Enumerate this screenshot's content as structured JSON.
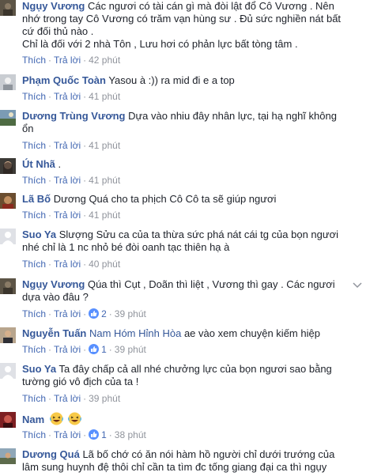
{
  "comments": [
    {
      "author": "Ngụy Vương",
      "tag": "",
      "lines": [
        "Các ngươi có tài cán gì mà đòi lật đổ Cô Vương . Nên",
        "nhớ trong tay Cô Vương có trăm vạn hùng sư . Đủ sức nghiền nát bất",
        "cứ đối thủ nào .",
        "Chỉ là đối với 2 nhà Tôn , Lưu hơi có phản lực bất tòng tâm ."
      ],
      "like": "Thích",
      "reply": "Trả lời",
      "reactions": "",
      "time": "42 phút",
      "avatar": "dark-warrior-avatar"
    },
    {
      "author": "Phạm Quốc Toàn",
      "tag": "",
      "lines": [
        "Yasou à :)) ra mid đi e a top"
      ],
      "like": "Thích",
      "reply": "Trả lời",
      "reactions": "",
      "time": "41 phút",
      "avatar": "silver-avatar"
    },
    {
      "author": "Dương Trùng Vương",
      "tag": "",
      "lines": [
        "Dựa vào nhiu đây nhân lực, tại hạ nghĩ không",
        "ổn"
      ],
      "like": "Thích",
      "reply": "Trả lời",
      "reactions": "",
      "time": "41 phút",
      "avatar": "landscape-avatar"
    },
    {
      "author": "Út Nhã",
      "tag": "",
      "lines": [
        "."
      ],
      "like": "Thích",
      "reply": "Trả lời",
      "reactions": "",
      "time": "41 phút",
      "avatar": "woman-avatar"
    },
    {
      "author": "Lã Bố",
      "tag": "",
      "lines": [
        "Dương Quá cho ta phịch Cô Cô ta sẽ giúp ngươi"
      ],
      "like": "Thích",
      "reply": "Trả lời",
      "reactions": "",
      "time": "41 phút",
      "avatar": "warrior-avatar"
    },
    {
      "author": "Suo Ya",
      "tag": "",
      "lines": [
        "Slượng Sửu ca của ta thừa sức phá nát cái tg của bọn ngươi",
        "nhé chỉ là 1 nc nhỏ bé đòi oanh tạc thiên hạ à"
      ],
      "like": "Thích",
      "reply": "Trả lời",
      "reactions": "",
      "time": "40 phút",
      "avatar": "default-avatar"
    },
    {
      "author": "Ngụy Vương",
      "tag": "",
      "lines": [
        "Qúa thì Cụt , Doãn thì liệt , Vương thì gay . Các ngươi",
        "dựa vào đâu ?"
      ],
      "like": "Thích",
      "reply": "Trả lời",
      "reactions": "2",
      "time": "39 phút",
      "avatar": "dark-warrior-avatar"
    },
    {
      "author": "Nguyễn Tuấn",
      "tag": "Nam Hóm Hỉnh Hòa",
      "lines": [
        "ae vào xem chuyện kiếm hiệp"
      ],
      "like": "Thích",
      "reply": "Trả lời",
      "reactions": "1",
      "time": "39 phút",
      "avatar": "man-avatar"
    },
    {
      "author": "Suo Ya",
      "tag": "",
      "lines": [
        "Ta đây chấp cả all nhé chưởng lực của bọn ngươi sao bằng",
        "tường gió vô địch của ta !"
      ],
      "like": "Thích",
      "reply": "Trả lời",
      "reactions": "",
      "time": "39 phút",
      "avatar": "default-avatar"
    },
    {
      "author": "Nam",
      "tag": "",
      "lines": [
        ""
      ],
      "like": "Thích",
      "reply": "Trả lời",
      "reactions": "1",
      "time": "38 phút",
      "avatar": "red-avatar"
    },
    {
      "author": "Dương Quá",
      "tag": "",
      "lines": [
        "Lã bố chớ có ăn nói hàm hồ người chỉ dưới trướng của",
        "lâm sung huynh đệ thôi chỉ cần ta tìm đc tống giang đại ca thì ngụy"
      ],
      "like": "",
      "reply": "",
      "reactions": "",
      "time": "",
      "avatar": "outdoor-avatar"
    }
  ],
  "colors": {
    "name": "#365899",
    "meta": "#90949c",
    "link": "#4267b2",
    "text": "#1d2129"
  }
}
